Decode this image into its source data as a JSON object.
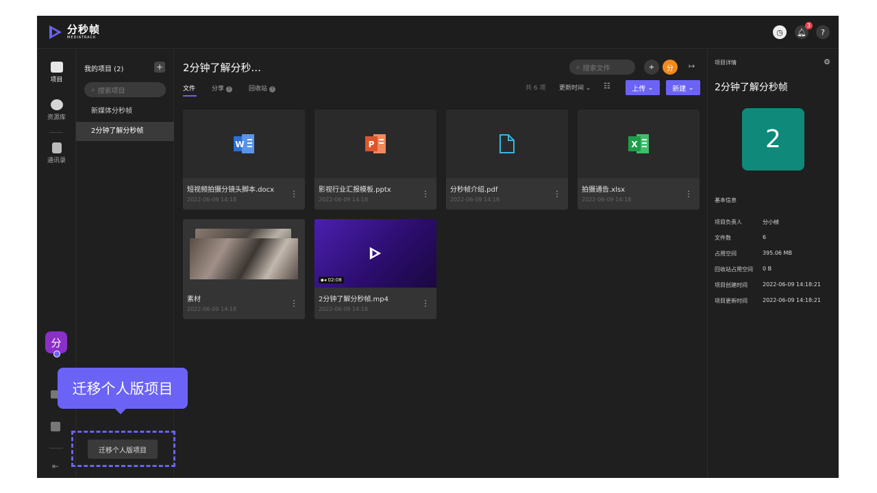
{
  "app": {
    "logo_cn": "分秒帧",
    "logo_en": "MEDIATRACK",
    "notif_count": "3",
    "help": "?"
  },
  "iconbar": {
    "items": [
      {
        "label": "项目"
      },
      {
        "label": "资源库"
      },
      {
        "label": "通讯录"
      }
    ],
    "avatar": "分"
  },
  "sidebar": {
    "title": "我的项目 (2)",
    "add": "+",
    "search_placeholder": "搜索项目",
    "projects": [
      "新媒体分秒帧",
      "2分钟了解分秒帧"
    ]
  },
  "main": {
    "title": "2分钟了解分秒...",
    "tabs": [
      "文件",
      "分享",
      "回收站"
    ],
    "search_placeholder": "搜索文件",
    "user_avatar": "分",
    "count": "共 6 项",
    "sort": "更新时间",
    "upload": "上传",
    "new": "新建",
    "files": [
      {
        "name": "短视频拍摄分镜头脚本.docx",
        "date": "2022-06-09 14:18",
        "type": "word"
      },
      {
        "name": "影视行业汇报模板.pptx",
        "date": "2022-06-09 14:18",
        "type": "ppt"
      },
      {
        "name": "分秒帧介绍.pdf",
        "date": "2022-06-09 14:18",
        "type": "pdf"
      },
      {
        "name": "拍摄通告.xlsx",
        "date": "2022-06-09 14:18",
        "type": "excel"
      },
      {
        "name": "素材",
        "date": "2022-06-09 14:18",
        "type": "folder"
      },
      {
        "name": "2分钟了解分秒帧.mp4",
        "date": "2022-06-09 14:18",
        "type": "video",
        "duration": "02:08"
      }
    ]
  },
  "detail": {
    "header": "项目详情",
    "name": "2分钟了解分秒帧",
    "cover": "2",
    "section": "基本信息",
    "rows": [
      {
        "k": "项目负责人",
        "v": "分小帧"
      },
      {
        "k": "文件数",
        "v": "6"
      },
      {
        "k": "占用空间",
        "v": "395.06 MB"
      },
      {
        "k": "回收站占用空间",
        "v": "0 B"
      },
      {
        "k": "项目创建时间",
        "v": "2022-06-09 14:18:21"
      },
      {
        "k": "项目更新时间",
        "v": "2022-06-09 14:18:21"
      }
    ]
  },
  "tooltip": "迁移个人版项目",
  "migrate_button": "迁移个人版项目",
  "colors": {
    "accent": "#6b63f5",
    "word": "#2b6fd6",
    "ppt": "#e0552b",
    "excel": "#1e9e4a",
    "pdf": "#38b6e8",
    "cover": "#0f8a7a",
    "avatar_bg": "#8b2fc9",
    "user_avatar_bg": "#f08a1c"
  }
}
